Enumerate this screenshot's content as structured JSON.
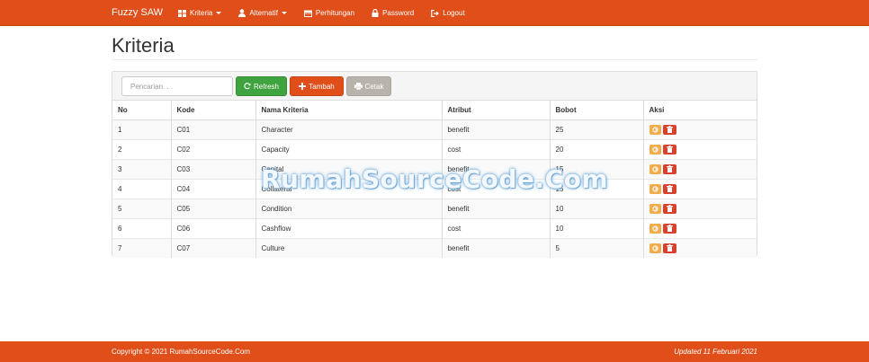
{
  "nav": {
    "brand": "Fuzzy SAW",
    "items": [
      {
        "label": "Kriteria",
        "icon": "grid-icon",
        "dropdown": true
      },
      {
        "label": "Alternatif",
        "icon": "user-icon",
        "dropdown": true
      },
      {
        "label": "Perhitungan",
        "icon": "calendar-icon",
        "dropdown": false
      },
      {
        "label": "Password",
        "icon": "lock-icon",
        "dropdown": false
      },
      {
        "label": "Logout",
        "icon": "logout-icon",
        "dropdown": false
      }
    ]
  },
  "page": {
    "title": "Kriteria"
  },
  "toolbar": {
    "search_placeholder": "Pencarian. . .",
    "refresh_label": "Refresh",
    "add_label": "Tambah",
    "print_label": "Cetak"
  },
  "table": {
    "headers": [
      "No",
      "Kode",
      "Nama Kriteria",
      "Atribut",
      "Bobot",
      "Aksi"
    ],
    "rows": [
      [
        "1",
        "C01",
        "Character",
        "benefit",
        "25"
      ],
      [
        "2",
        "C02",
        "Capacity",
        "cost",
        "20"
      ],
      [
        "3",
        "C03",
        "Capital",
        "benefit",
        "15"
      ],
      [
        "4",
        "C04",
        "Collateral",
        "cost",
        "15"
      ],
      [
        "5",
        "C05",
        "Condition",
        "benefit",
        "10"
      ],
      [
        "6",
        "C06",
        "Cashflow",
        "cost",
        "10"
      ],
      [
        "7",
        "C07",
        "Culture",
        "benefit",
        "5"
      ]
    ]
  },
  "watermark": "RumahSourceCode.Com",
  "footer": {
    "copyright": "Copyright © 2021 RumahSourceCode.Com",
    "updated": "Updated 11 Februari 2021"
  },
  "colors": {
    "primary": "#e04e1a",
    "success": "#3fa33f",
    "muted": "#b8b3ac",
    "warning": "#f0ad4e",
    "danger": "#d9412c"
  }
}
